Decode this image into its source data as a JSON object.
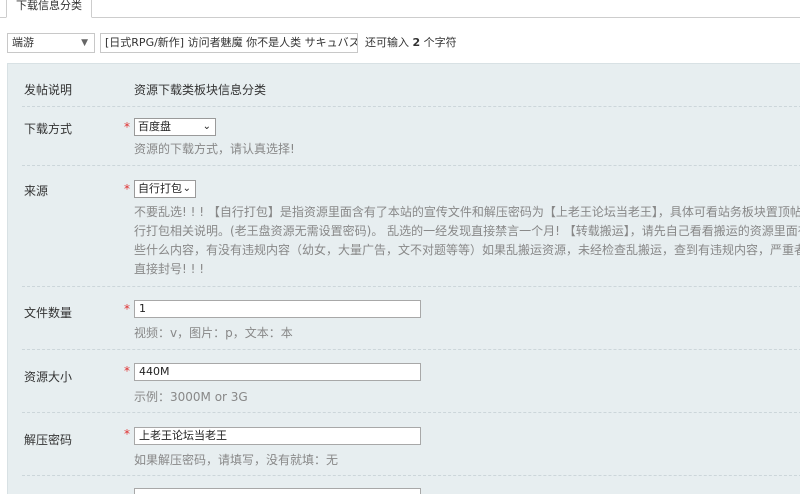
{
  "tab": {
    "label": "下载信息分类"
  },
  "topbar": {
    "type_value": "端游",
    "title_value": "[日式RPG/新作] 访问者魅魔 你不是人类 サキュバスAI汉",
    "hint_prefix": "还可输入",
    "hint_count": "2",
    "hint_suffix": "个字符"
  },
  "form": {
    "posting_note": {
      "label": "发帖说明",
      "value": "资源下载类板块信息分类"
    },
    "download_method": {
      "label": "下载方式",
      "required_mark": "*",
      "selected": "百度盘",
      "hint": "资源的下载方式，请认真选择!"
    },
    "source": {
      "label": "来源",
      "required_mark": "*",
      "selected": "自行打包",
      "hint": "不要乱选! ! ! 【自行打包】是指资源里面含有了本站的宣传文件和解压密码为【上老王论坛当老王】，具体可看站务板块置顶帖自行打包相关说明。(老王盘资源无需设置密码)。 乱选的一经发现直接禁言一个月! 【转载搬运】，请先自己看看搬运的资源里面有些什么内容，有没有违规内容（幼女，大量广告，文不对题等等）如果乱搬运资源，未经检查乱搬运，查到有违规内容，严重者直接封号! ! !"
    },
    "file_count": {
      "label": "文件数量",
      "required_mark": "*",
      "value": "1",
      "hint": "视频：v，图片：p，文本：本"
    },
    "resource_size": {
      "label": "资源大小",
      "required_mark": "*",
      "value": "440M",
      "hint": "示例：3000M or 3G"
    },
    "unzip_password": {
      "label": "解压密码",
      "required_mark": "*",
      "value": "上老王论坛当老王",
      "hint": "如果解压密码，请填写，没有就填：无"
    }
  }
}
